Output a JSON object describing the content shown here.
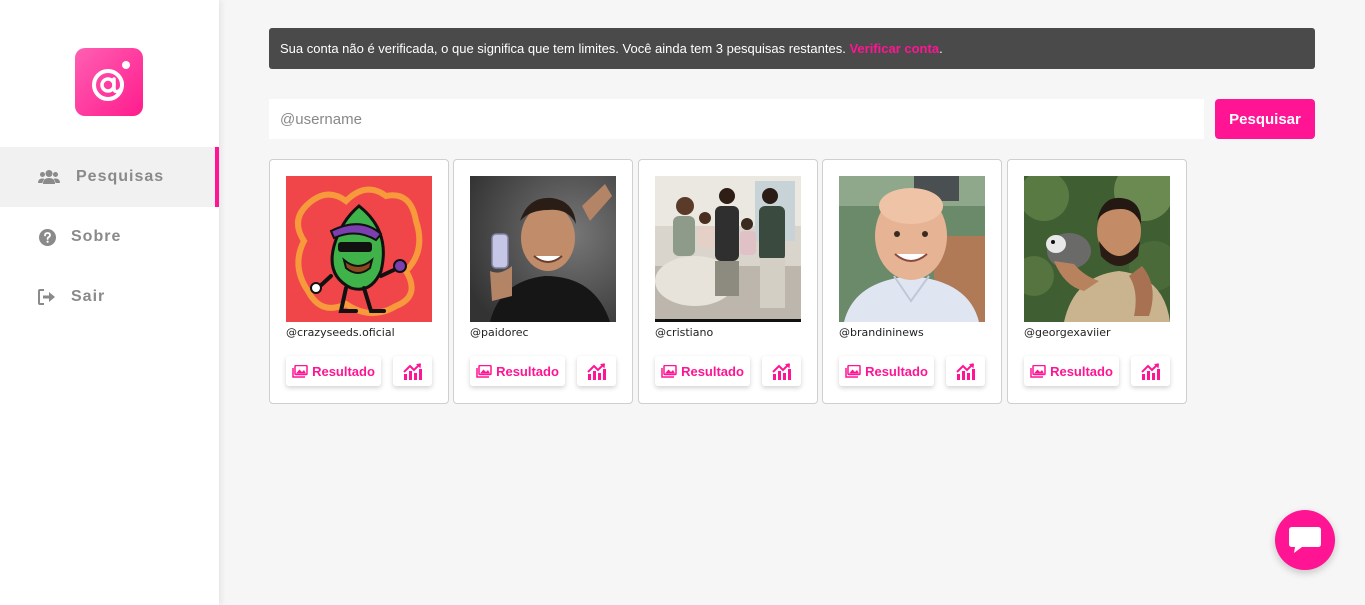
{
  "sidebar": {
    "logo_icon": "at-sign-logo",
    "items": [
      {
        "label": "Pesquisas",
        "icon": "users-icon",
        "active": true
      },
      {
        "label": "Sobre",
        "icon": "question-circle-icon"
      },
      {
        "label": "Sair",
        "icon": "sign-out-icon"
      }
    ]
  },
  "alert": {
    "text": "Sua conta não é verificada, o que significa que tem limites. Você ainda tem 3 pesquisas restantes. ",
    "link": "Verificar conta",
    "suffix": "."
  },
  "search": {
    "placeholder": "@username",
    "button": "Pesquisar"
  },
  "cards": [
    {
      "username": "@crazyseeds.oficial",
      "result_label": "Resultado"
    },
    {
      "username": "@paidorec",
      "result_label": "Resultado"
    },
    {
      "username": "@cristiano",
      "result_label": "Resultado"
    },
    {
      "username": "@brandininews",
      "result_label": "Resultado"
    },
    {
      "username": "@georgexaviier",
      "result_label": "Resultado"
    }
  ],
  "colors": {
    "accent": "#ff1493",
    "alert_bg": "#4a4a4a",
    "sidebar_bg": "#ffffff",
    "page_bg": "#f6f6f6"
  }
}
